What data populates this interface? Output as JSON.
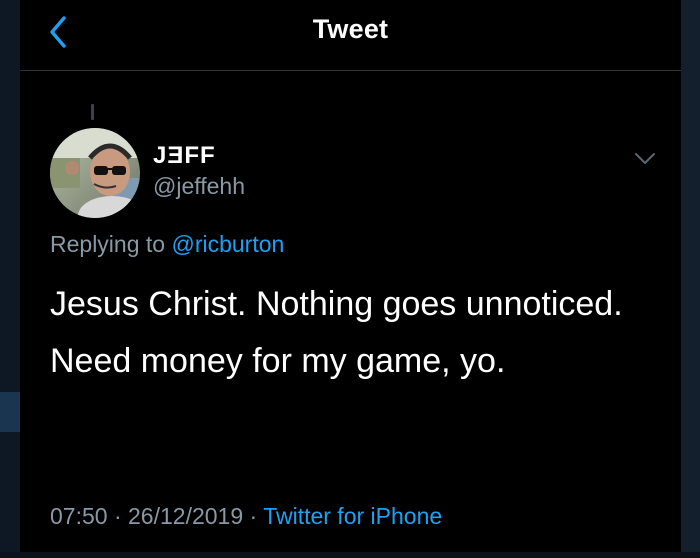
{
  "header": {
    "title": "Tweet",
    "back_icon": "chevron-left-icon"
  },
  "tweet": {
    "author": {
      "name": "JƎFF",
      "handle": "@jeffehh"
    },
    "replying_prefix": "Replying to",
    "replying_to": "@ricburton",
    "text": "Jesus Christ. Nothing goes unnoticed. Need money for my game, yo.",
    "time": "07:50",
    "date": "26/12/2019",
    "separator": "·",
    "source": "Twitter for iPhone",
    "more_icon": "chevron-down-icon"
  },
  "colors": {
    "background": "#000000",
    "accent": "#1da1f2",
    "secondary_text": "#8899a6",
    "divider": "#2f3336"
  }
}
